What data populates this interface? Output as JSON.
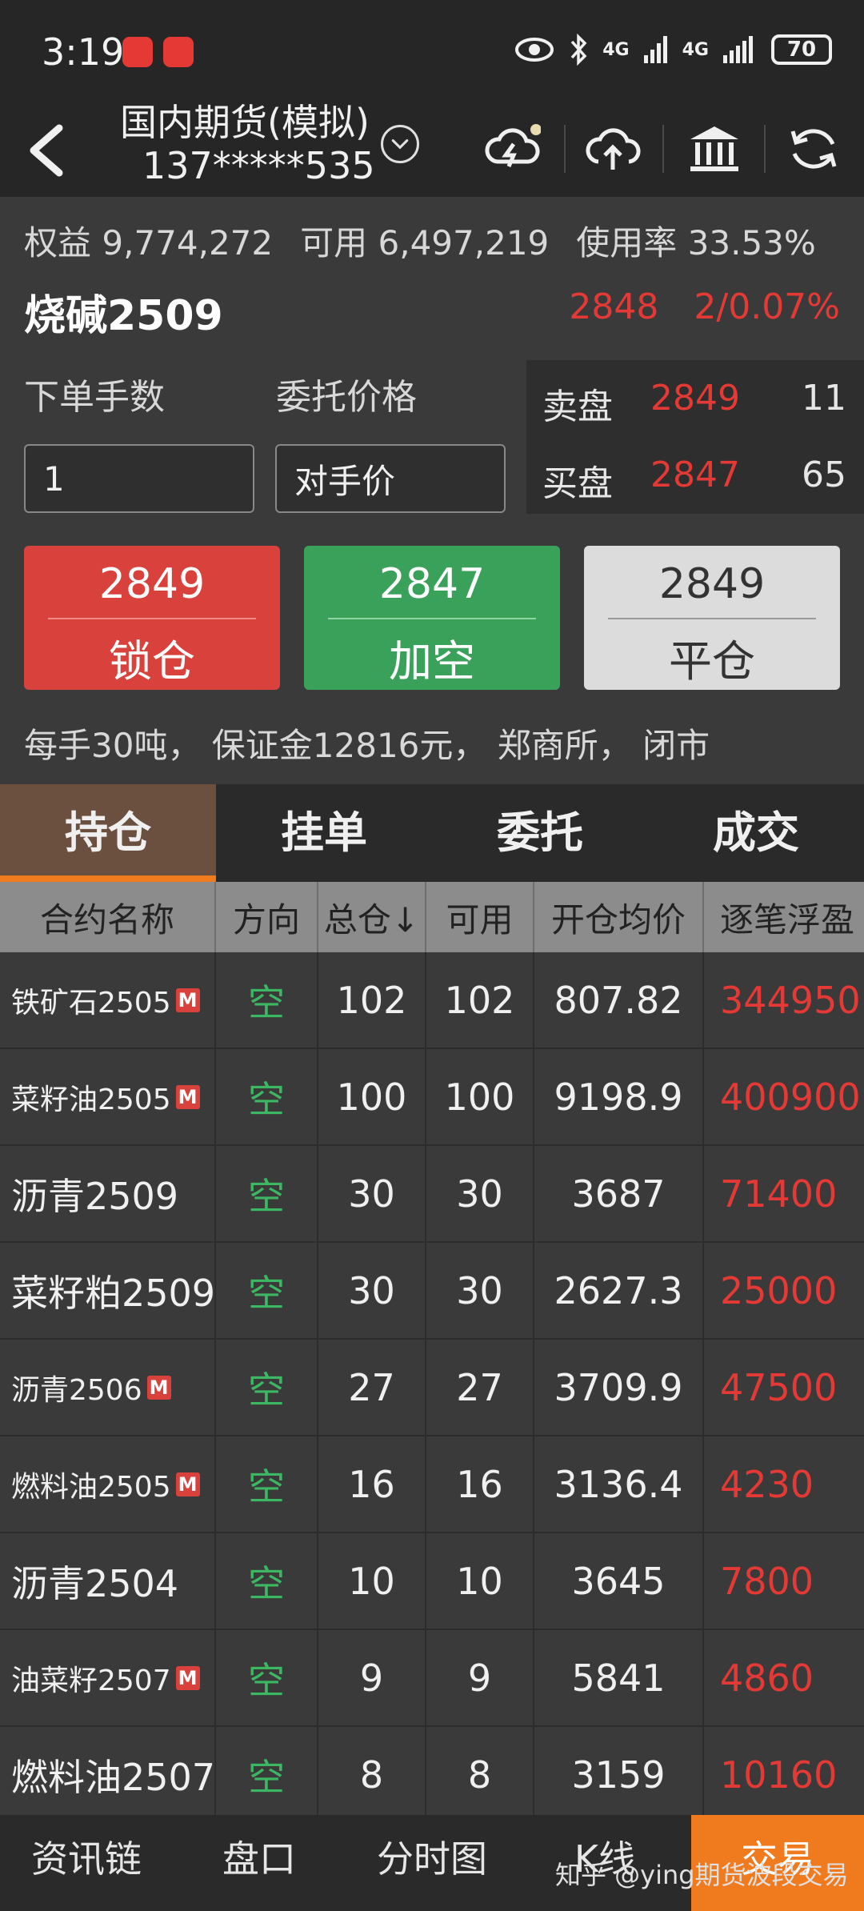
{
  "status": {
    "time": "3:19",
    "signal1": "4G",
    "signal2": "4G",
    "battery": "70"
  },
  "header": {
    "title": "国内期货(模拟)",
    "account": "137*****535"
  },
  "summary": {
    "equity_label": "权益",
    "equity": "9,774,272",
    "available_label": "可用",
    "available": "6,497,219",
    "usage_label": "使用率",
    "usage": "33.53%"
  },
  "contract": {
    "name": "烧碱2509",
    "price": "2848",
    "change": "2/0.07%"
  },
  "order": {
    "qty_label": "下单手数",
    "qty_value": "1",
    "price_label": "委托价格",
    "price_value": "对手价"
  },
  "book": {
    "ask_label": "卖盘",
    "ask_price": "2849",
    "ask_vol": "11",
    "bid_label": "买盘",
    "bid_price": "2847",
    "bid_vol": "65"
  },
  "buttons": [
    {
      "price": "2849",
      "action": "锁仓"
    },
    {
      "price": "2847",
      "action": "加空"
    },
    {
      "price": "2849",
      "action": "平仓"
    }
  ],
  "info": "每手30吨， 保证金12816元， 郑商所， 闭市",
  "tabs": [
    "持仓",
    "挂单",
    "委托",
    "成交"
  ],
  "table": {
    "headers": [
      "合约名称",
      "方向",
      "总仓↓",
      "可用",
      "开仓均价",
      "逐笔浮盈"
    ],
    "rows": [
      {
        "name": "铁矿石2505",
        "m": "M",
        "dir": "空",
        "total": "102",
        "avail": "102",
        "avg": "807.82",
        "pl": "344950"
      },
      {
        "name": "菜籽油2505",
        "m": "M",
        "dir": "空",
        "total": "100",
        "avail": "100",
        "avg": "9198.9",
        "pl": "400900"
      },
      {
        "name": "沥青2509",
        "m": "",
        "dir": "空",
        "total": "30",
        "avail": "30",
        "avg": "3687",
        "pl": "71400"
      },
      {
        "name": "菜籽粕2509",
        "m": "",
        "dir": "空",
        "total": "30",
        "avail": "30",
        "avg": "2627.3",
        "pl": "25000"
      },
      {
        "name": "沥青2506",
        "m": "M",
        "dir": "空",
        "total": "27",
        "avail": "27",
        "avg": "3709.9",
        "pl": "47500"
      },
      {
        "name": "燃料油2505",
        "m": "M",
        "dir": "空",
        "total": "16",
        "avail": "16",
        "avg": "3136.4",
        "pl": "4230"
      },
      {
        "name": "沥青2504",
        "m": "",
        "dir": "空",
        "total": "10",
        "avail": "10",
        "avg": "3645",
        "pl": "7800"
      },
      {
        "name": "油菜籽2507",
        "m": "M",
        "dir": "空",
        "total": "9",
        "avail": "9",
        "avg": "5841",
        "pl": "4860"
      },
      {
        "name": "燃料油2507",
        "m": "",
        "dir": "空",
        "total": "8",
        "avail": "8",
        "avg": "3159",
        "pl": "10160"
      }
    ]
  },
  "bottomnav": [
    "资讯链",
    "盘口",
    "分时图",
    "K线",
    "交易"
  ],
  "watermark": "知乎 @ying期货波段交易",
  "colors": {
    "up": "#e53935",
    "down": "#3cb863",
    "accent": "#f07a1e"
  }
}
